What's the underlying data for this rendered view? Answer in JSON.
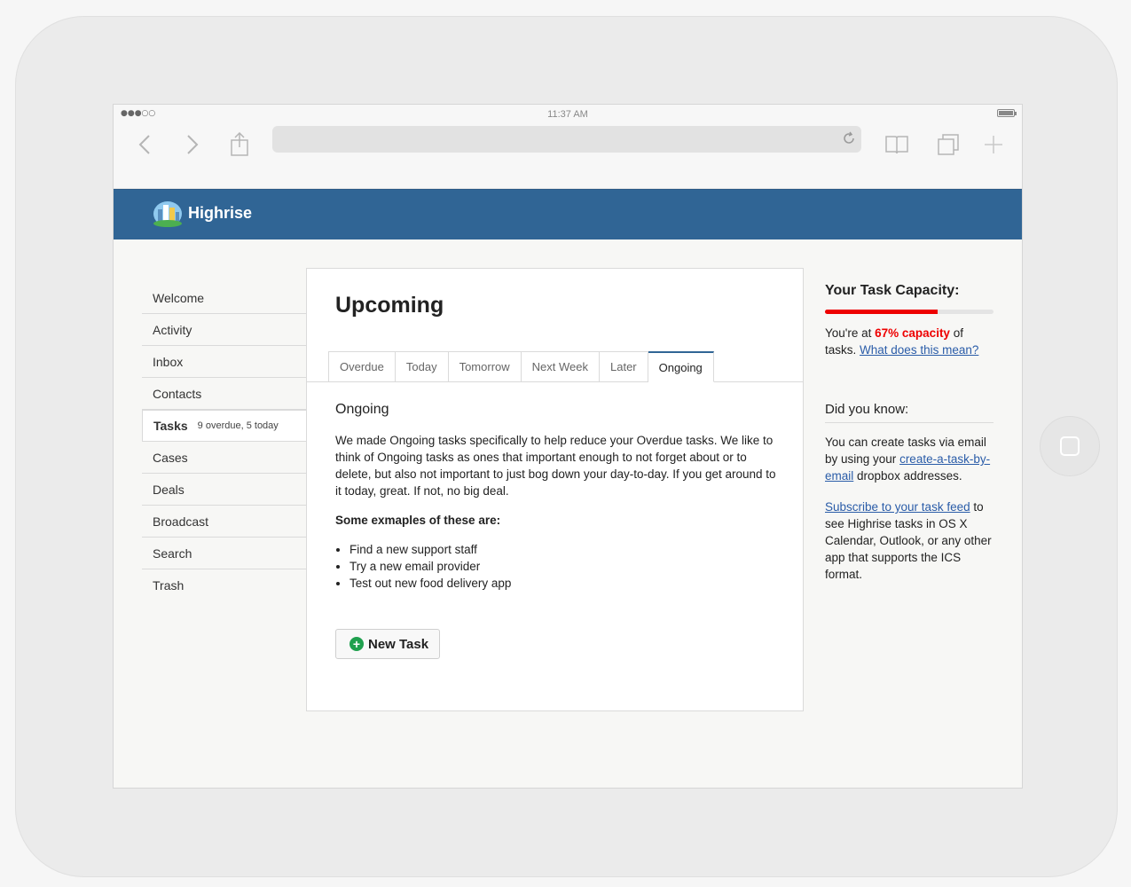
{
  "statusbar": {
    "time": "11:37 AM",
    "signal": "●●●○○"
  },
  "app": {
    "brand": "Highrise",
    "colors": {
      "header": "#306595",
      "accent": "#2a5ca8",
      "capacity": "#ee0000",
      "success": "#1fa04e"
    }
  },
  "nav": {
    "items": [
      {
        "label": "Welcome",
        "meta": ""
      },
      {
        "label": "Activity",
        "meta": ""
      },
      {
        "label": "Inbox",
        "meta": ""
      },
      {
        "label": "Contacts",
        "meta": ""
      },
      {
        "label": "Tasks",
        "meta": "9 overdue, 5 today"
      },
      {
        "label": "Cases",
        "meta": ""
      },
      {
        "label": "Deals",
        "meta": ""
      },
      {
        "label": "Broadcast",
        "meta": ""
      },
      {
        "label": "Search",
        "meta": ""
      },
      {
        "label": "Trash",
        "meta": ""
      }
    ],
    "active": "Tasks"
  },
  "main": {
    "title": "Upcoming",
    "tabs": [
      {
        "label": "Overdue"
      },
      {
        "label": "Today"
      },
      {
        "label": "Tomorrow"
      },
      {
        "label": "Next Week"
      },
      {
        "label": "Later"
      },
      {
        "label": "Ongoing"
      }
    ],
    "active_tab": "Ongoing",
    "section_title": "Ongoing",
    "description": "We made Ongoing tasks specifically to help reduce your Overdue tasks. We like to think of Ongoing tasks as ones that important enough to not forget about or to delete, but also not important to just bog down your day-to-day. If you get around to it today, great. If not, no big deal.",
    "examples_label": "Some exmaples of these are:",
    "examples": [
      "Find a new support staff",
      "Try a new email provider",
      "Test out new food delivery app"
    ],
    "new_task_label": "New Task"
  },
  "sidebar": {
    "capacity_title": "Your Task Capacity:",
    "capacity_fraction": 0.67,
    "capacity_prefix": "You're at",
    "capacity_value": "67% capacity",
    "capacity_suffix": "of tasks.",
    "capacity_link": "What does this mean?",
    "dyk_title": "Did you know:",
    "dyk_p1_prefix": "You can create tasks via email by using your",
    "dyk_p1_link": "create-a-task-by-email",
    "dyk_p1_suffix": "dropbox addresses.",
    "dyk_p2_link": "Subscribe to your task feed",
    "dyk_p2_suffix": "to see Highrise tasks in OS X Calendar, Outlook, or any other app that supports the ICS format."
  }
}
